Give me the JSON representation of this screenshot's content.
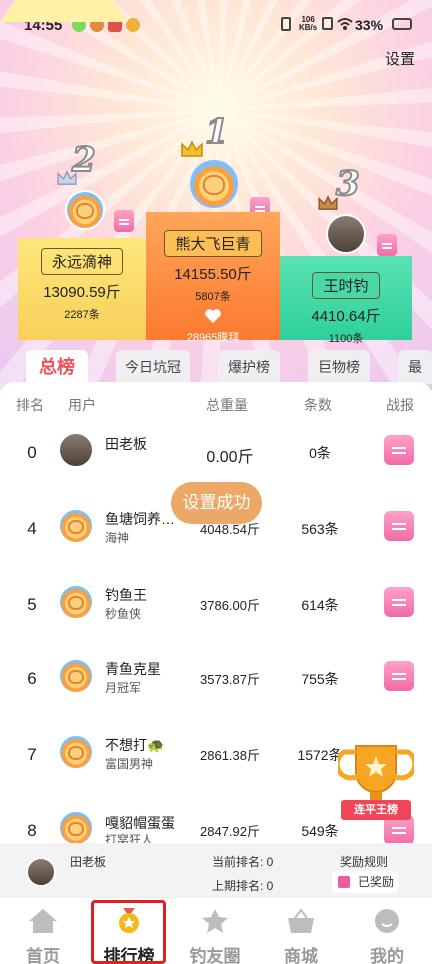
{
  "status_bar": {
    "time": "14:55",
    "net_speed_top": "106",
    "net_speed_bottom": "KB/s",
    "battery": "33%"
  },
  "header": {
    "settings_label": "设置"
  },
  "podium": {
    "first": {
      "rank": "1",
      "name": "熊大飞巨青",
      "weight": "14155.50斤",
      "count": "5807条",
      "likes": "28965膜拜"
    },
    "second": {
      "rank": "2",
      "name": "永远滴神",
      "weight": "13090.59斤",
      "count": "2287条"
    },
    "third": {
      "rank": "3",
      "name": "王时钓",
      "weight": "4410.64斤",
      "count": "1100条"
    }
  },
  "tabs": [
    "总榜",
    "今日坑冠",
    "爆护榜",
    "巨物榜",
    "最"
  ],
  "table": {
    "headers": {
      "rank": "排名",
      "user": "用户",
      "weight": "总重量",
      "count": "条数",
      "report": "战报"
    },
    "rows": [
      {
        "rank": "0",
        "name": "田老板",
        "title": "",
        "weight": "0.00斤",
        "count": "0条"
      },
      {
        "rank": "4",
        "name": "鱼塘饲养…",
        "title": "海神",
        "weight": "4048.54斤",
        "count": "563条"
      },
      {
        "rank": "5",
        "name": "钓鱼王",
        "title": "秒鱼侠",
        "weight": "3786.00斤",
        "count": "614条"
      },
      {
        "rank": "6",
        "name": "青鱼克星",
        "title": "月冠军",
        "weight": "3573.87斤",
        "count": "755条"
      },
      {
        "rank": "7",
        "name": "不想打🐢",
        "title": "富国男神",
        "weight": "2861.38斤",
        "count": "1572条"
      },
      {
        "rank": "8",
        "name": "嘎貂帽蛋蛋",
        "title": "打窝狂人",
        "weight": "2847.92斤",
        "count": "549条"
      }
    ]
  },
  "toast": "设置成功",
  "trophy_label": "连平王榜",
  "my_bar": {
    "name": "田老板",
    "current_rank": "当前排名: 0",
    "last_rank": "上期排名: 0",
    "reward_rules": "奖励规则",
    "rewarded": "已奖励"
  },
  "nav": [
    "首页",
    "排行榜",
    "钓友圈",
    "商城",
    "我的"
  ],
  "colors": {
    "accent": "#f0505a",
    "toast": "#eba05a",
    "gold": "#fb7a2f",
    "green": "#2fcf9b",
    "yellow": "#f8d05b"
  }
}
